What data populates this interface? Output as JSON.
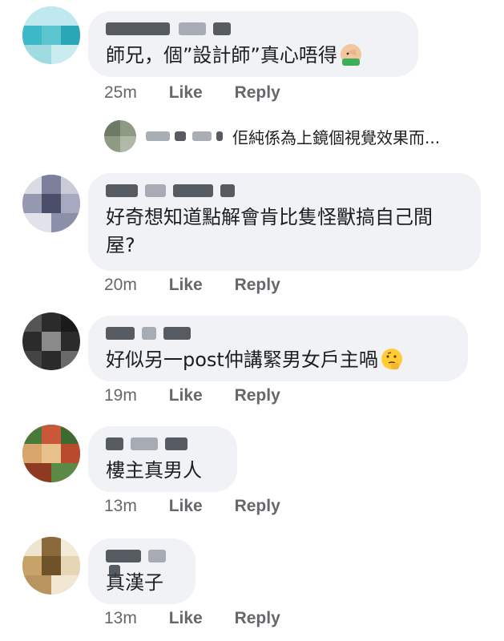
{
  "comments": [
    {
      "text": "師兄，個”設計師”真心唔得",
      "emoji": "facepalm-emoji",
      "time": "25m",
      "like": "Like",
      "reply": "Reply"
    },
    {
      "text": "好奇想知道點解會肯比隻怪獸搞自己間屋?",
      "time": "20m",
      "like": "Like",
      "reply": "Reply"
    },
    {
      "text": "好似另一post仲講緊男女戶主喎",
      "emoji": "thinking-emoji",
      "time": "19m",
      "like": "Like",
      "reply": "Reply"
    },
    {
      "text": "樓主真男人",
      "time": "13m",
      "like": "Like",
      "reply": "Reply"
    },
    {
      "text": "真漢子",
      "time": "13m",
      "like": "Like",
      "reply": "Reply"
    }
  ],
  "reply_preview": {
    "text": "佢純係為上鏡個視覺效果而..."
  },
  "colors": {
    "bubble": "#f0f2f5",
    "meta": "#65676b",
    "text": "#1c1e21"
  }
}
